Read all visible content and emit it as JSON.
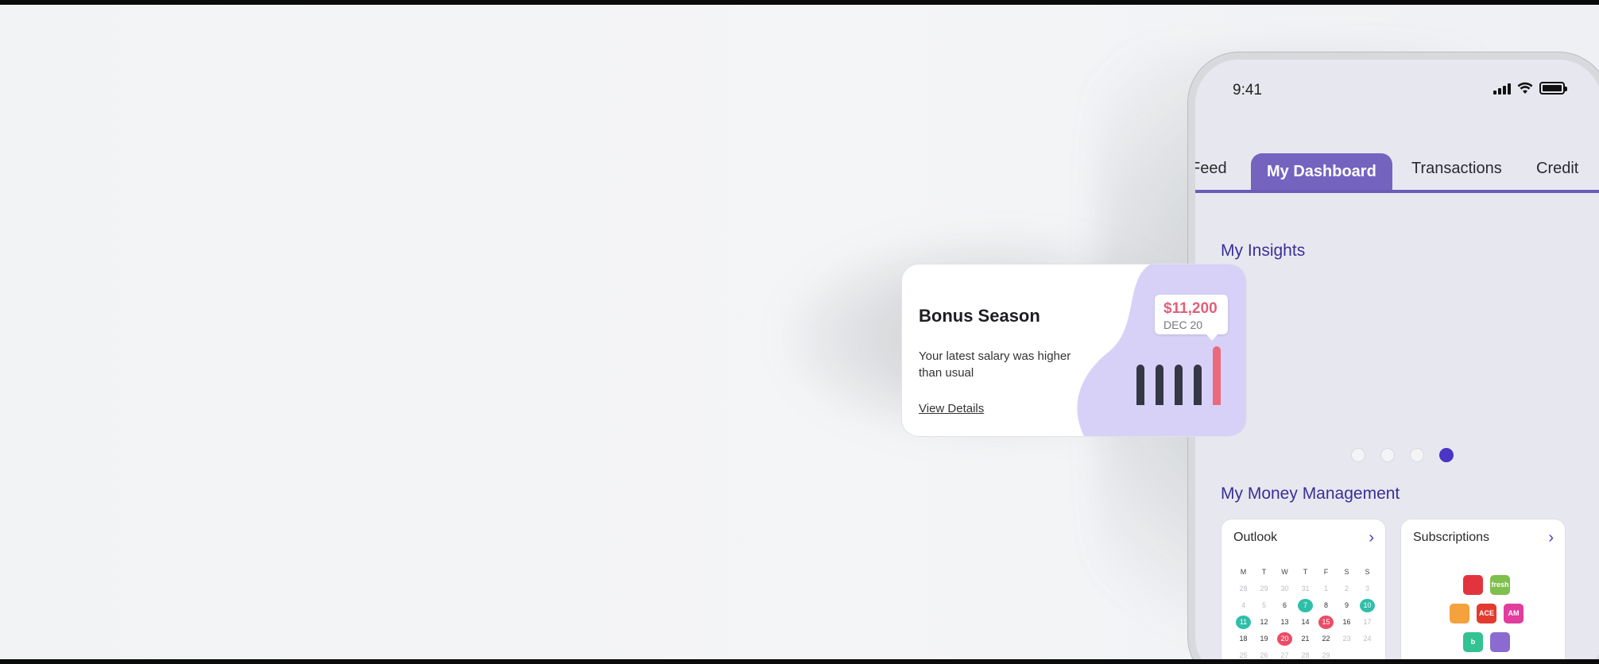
{
  "phone": {
    "status_time": "9:41",
    "tabs": [
      "Feed",
      "My Dashboard",
      "Transactions",
      "Credit"
    ],
    "active_tab": "My Dashboard",
    "insights_title": "My Insights",
    "money_title": "My Money Management",
    "carousel": {
      "total": 4,
      "active_index": 4
    },
    "outlook": {
      "title": "Outlook",
      "weekdays": [
        "M",
        "T",
        "W",
        "T",
        "F",
        "S",
        "S"
      ],
      "weeks": [
        [
          "28",
          "29",
          "30",
          "31",
          "1",
          "2",
          "3"
        ],
        [
          "4",
          "5",
          "6",
          "7",
          "8",
          "9",
          "10"
        ],
        [
          "11",
          "12",
          "13",
          "14",
          "15",
          "16",
          "17"
        ],
        [
          "18",
          "19",
          "20",
          "21",
          "22",
          "23",
          "24"
        ],
        [
          "25",
          "26",
          "27",
          "28",
          "29",
          "",
          ""
        ]
      ],
      "highlights": {
        "teal": [
          "7",
          "10",
          "11"
        ],
        "red": [
          "15",
          "20"
        ]
      }
    },
    "subscriptions": {
      "title": "Subscriptions",
      "apps": [
        {
          "icon": "creative-cloud-icon",
          "label": "",
          "color": "#e2343d"
        },
        {
          "icon": "amazon-fresh-icon",
          "label": "fresh",
          "color": "#7fbf4d"
        },
        {
          "icon": "audible-icon",
          "label": "",
          "color": "#f5a13c"
        },
        {
          "icon": "ace-icon",
          "label": "ACE",
          "color": "#e33b2f"
        },
        {
          "icon": "am-app-icon",
          "label": "AM",
          "color": "#e23c9d"
        },
        {
          "icon": "bumble-icon",
          "label": "b",
          "color": "#33c291"
        },
        {
          "icon": "fitness-app-icon",
          "label": "",
          "color": "#8b6bd0"
        }
      ]
    }
  },
  "insight_card": {
    "title": "Bonus Season",
    "body": "Your latest salary was higher than usual",
    "link": "View Details",
    "amount": "$11,200",
    "date": "DEC 20"
  },
  "chart_data": {
    "type": "bar",
    "categories": [
      "1",
      "2",
      "3",
      "4",
      "5"
    ],
    "values": [
      0.57,
      0.57,
      0.57,
      0.57,
      0.82
    ],
    "highlight_index": 4
  },
  "colors": {
    "accent": "#7563c0",
    "heading": "#3b2f98",
    "active_dot": "#4a35c4",
    "highlight_bar": "#ea6a7c",
    "bar": "#353646",
    "blob": "#d7d1f7"
  }
}
